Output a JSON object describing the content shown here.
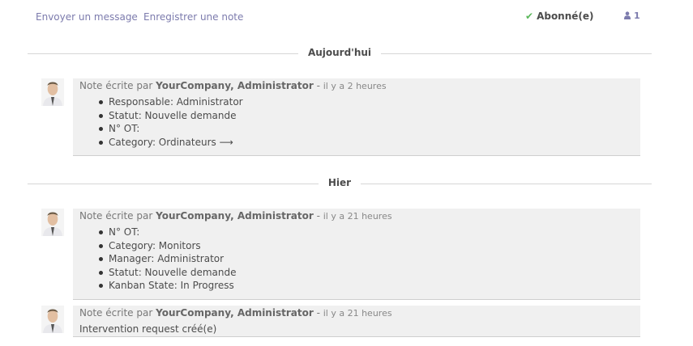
{
  "toolbar": {
    "send_message": "Envoyer un message",
    "log_note": "Enregistrer une note",
    "follow_label": "Abonné(e)",
    "followers_count": "1"
  },
  "groups": [
    {
      "date_label": "Aujourd'hui",
      "messages": [
        {
          "prefix": "Note écrite par",
          "author": "YourCompany, Administrator",
          "sep": " - ",
          "when": "il y a 2 heures",
          "items": [
            "Responsable: Administrator",
            "Statut: Nouvelle demande",
            "N° OT:",
            "Category: Ordinateurs ⟶"
          ]
        }
      ]
    },
    {
      "date_label": "Hier",
      "messages": [
        {
          "prefix": "Note écrite par",
          "author": "YourCompany, Administrator",
          "sep": " - ",
          "when": "il y a 21 heures",
          "items": [
            "N° OT:",
            "Category: Monitors",
            "Manager: Administrator",
            "Statut: Nouvelle demande",
            "Kanban State: In Progress"
          ]
        },
        {
          "prefix": "Note écrite par",
          "author": "YourCompany, Administrator",
          "sep": " - ",
          "when": "il y a 21 heures",
          "body": "Intervention request créé(e)"
        }
      ]
    }
  ],
  "colors": {
    "link": "#7c7bad",
    "check": "#5cb85c",
    "card_bg": "#f0f0f0"
  }
}
